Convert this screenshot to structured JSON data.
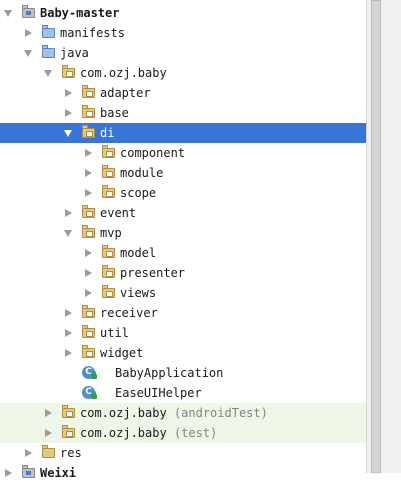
{
  "tree": {
    "root_label": "Baby-master",
    "items": [
      {
        "label": "manifests"
      },
      {
        "label": "java"
      },
      {
        "label": "com.ozj.baby"
      },
      {
        "label": "adapter"
      },
      {
        "label": "base"
      },
      {
        "label": "di"
      },
      {
        "label": "component"
      },
      {
        "label": "module"
      },
      {
        "label": "scope"
      },
      {
        "label": "event"
      },
      {
        "label": "mvp"
      },
      {
        "label": "model"
      },
      {
        "label": "presenter"
      },
      {
        "label": "views"
      },
      {
        "label": "receiver"
      },
      {
        "label": "util"
      },
      {
        "label": "widget"
      },
      {
        "label": "BabyApplication",
        "icon_text": "C"
      },
      {
        "label": "EaseUIHelper",
        "icon_text": "C"
      },
      {
        "label": "com.ozj.baby",
        "suffix": "(androidTest)"
      },
      {
        "label": "com.ozj.baby",
        "suffix": "(test)"
      },
      {
        "label": "res"
      },
      {
        "label": "Weixi"
      }
    ],
    "selected_item": "di"
  },
  "colors": {
    "selection": "#3875d7",
    "test_highlight": "#eef6e7",
    "folder": "#e6c87a",
    "source_folder": "#9ec2ea",
    "class_icon": "#4d8fd6"
  }
}
